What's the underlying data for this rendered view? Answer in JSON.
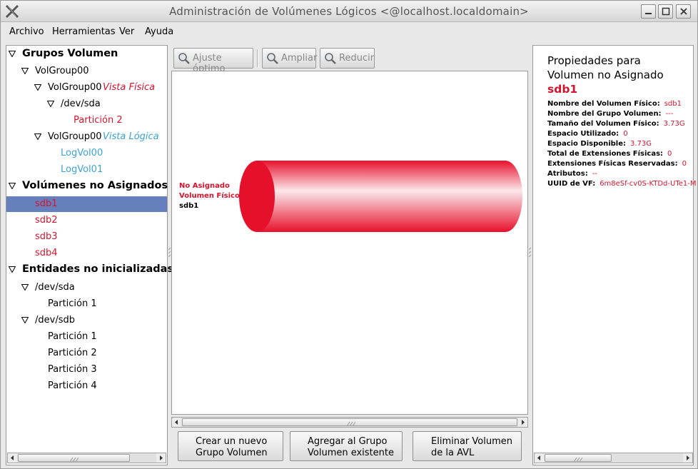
{
  "window": {
    "title": "Administración de Volúmenes Lógicos <@localhost.localdomain>"
  },
  "menu": [
    "Archivo",
    "Herramientas",
    "Ver",
    "Ayuda"
  ],
  "tree": {
    "groups_header": "Grupos Volumen",
    "vg": "VolGroup00",
    "vg_physical": "VolGroup00",
    "physical_view": "Vista Física",
    "dev_sda": "/dev/sda",
    "particion2": "Partición 2",
    "vg_logical": "VolGroup00",
    "logical_view": "Vista Lógica",
    "logvol00": "LogVol00",
    "logvol01": "LogVol01",
    "unassigned_header": "Volúmenes no Asignados",
    "unassigned": [
      "sdb1",
      "sdb2",
      "sdb3",
      "sdb4"
    ],
    "uninit_header": "Entidades no inicializadas",
    "uninit_sda": "/dev/sda",
    "uninit_sda_p1": "Partición 1",
    "uninit_sdb": "/dev/sdb",
    "uninit_sdb_parts": [
      "Partición 1",
      "Partición 2",
      "Partición 3",
      "Partición 4"
    ]
  },
  "toolbar": {
    "best_fit": "Ajuste óptimo",
    "zoom_in": "Ampliar",
    "zoom_out": "Reducir"
  },
  "diagram": {
    "label1": "No Asignado",
    "label2": "Volumen Físico",
    "label3": "sdb1",
    "cylinder_color": "#e8102c"
  },
  "actions": {
    "create_vg": "Crear un nuevo\nGrupo Volumen",
    "add_to_vg": "Agregar al Grupo\nVolumen existente",
    "remove": "Eliminar Volumen\nde la AVL"
  },
  "properties": {
    "title_line1": "Propiedades para",
    "title_line2": "Volumen no Asignado",
    "name": "sdb1",
    "rows": [
      {
        "k": "Nombre del Volumen Físico:",
        "v": "sdb1"
      },
      {
        "k": "Nombre del Grupo Volumen:",
        "v": "---"
      },
      {
        "k": "Tamaño del Volumen Físico:",
        "v": "3.73G"
      },
      {
        "k": "Espacio Utilizado:",
        "v": "0"
      },
      {
        "k": "Espacio Disponible:",
        "v": "3.73G"
      },
      {
        "k": "Total de Extensiones Físicas:",
        "v": "0"
      },
      {
        "k": "Extensiones Físicas Reservadas:",
        "v": "0"
      },
      {
        "k": "Atributos:",
        "v": "--"
      },
      {
        "k": "UUID de VF:",
        "v": "6m8eSf-cv0S-KTDd-UTe1-M"
      }
    ]
  },
  "colors": {
    "selection": "#6580bd",
    "accent_red": "#d7142d",
    "accent_blue": "#3aa3d9"
  }
}
